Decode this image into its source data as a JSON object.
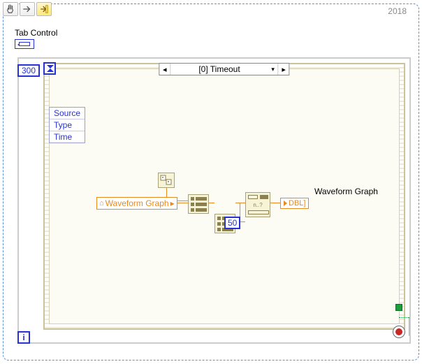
{
  "toolbar": {
    "pan_tip": "Pan",
    "step_tip": "Step",
    "run_tip": "Run"
  },
  "vi": {
    "year": "2018",
    "tab_control_label": "Tab Control"
  },
  "while_loop": {
    "timeout_ms": "300",
    "iteration_label": "i"
  },
  "event_structure": {
    "case_label": "[0] Timeout",
    "data_items": [
      "Source",
      "Type",
      "Time"
    ]
  },
  "diagram": {
    "local_var_label": "Waveform Graph",
    "indicator_label": "Waveform Graph",
    "dbl_text": "DBL]",
    "points_const": "50"
  }
}
